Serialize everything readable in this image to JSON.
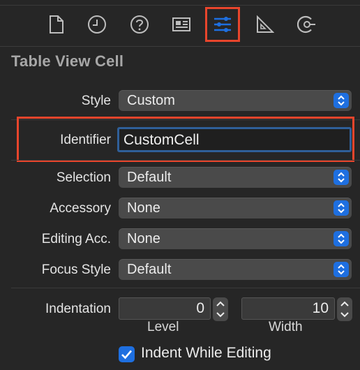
{
  "toolbar": {
    "tabs": [
      {
        "name": "file-inspector",
        "icon": "document-icon"
      },
      {
        "name": "history-inspector",
        "icon": "clock-icon"
      },
      {
        "name": "quick-help",
        "icon": "question-icon"
      },
      {
        "name": "identity-inspector",
        "icon": "id-card-icon"
      },
      {
        "name": "attributes-inspector",
        "icon": "sliders-icon",
        "active": true
      },
      {
        "name": "size-inspector",
        "icon": "ruler-icon"
      },
      {
        "name": "connections-inspector",
        "icon": "connection-icon"
      }
    ],
    "active_color": "#1e6fe0",
    "highlight_color": "#e8452c"
  },
  "section_title": "Table View Cell",
  "fields": {
    "style": {
      "label": "Style",
      "value": "Custom"
    },
    "identifier": {
      "label": "Identifier",
      "value": "CustomCell"
    },
    "selection": {
      "label": "Selection",
      "value": "Default"
    },
    "accessory": {
      "label": "Accessory",
      "value": "None"
    },
    "editing_acc": {
      "label": "Editing Acc.",
      "value": "None"
    },
    "focus_style": {
      "label": "Focus Style",
      "value": "Default"
    }
  },
  "indentation": {
    "label": "Indentation",
    "level": {
      "value": "0",
      "label": "Level"
    },
    "width": {
      "value": "10",
      "label": "Width"
    }
  },
  "indent_while_editing": {
    "label": "Indent While Editing",
    "checked": true
  }
}
